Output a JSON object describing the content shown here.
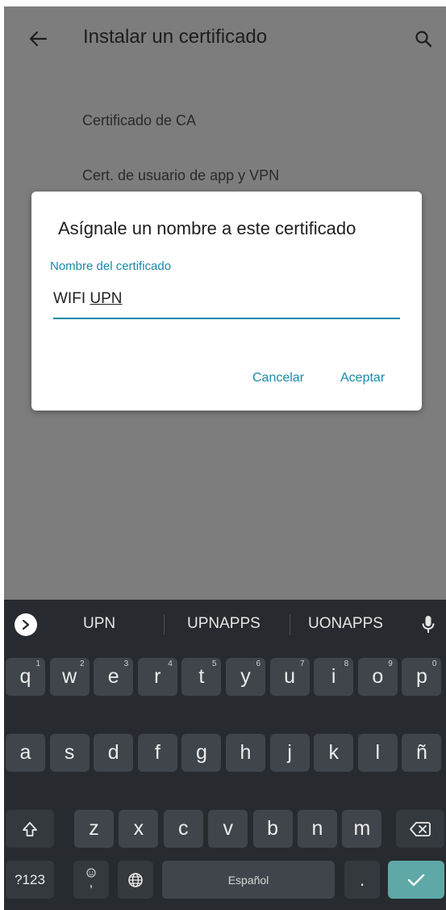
{
  "app_bar": {
    "title": "Instalar un certificado",
    "back_icon": "arrow-left-icon",
    "search_icon": "search-icon"
  },
  "settings": {
    "items": [
      {
        "label": "Certificado de CA"
      },
      {
        "label": "Cert. de usuario de app y VPN"
      }
    ]
  },
  "dialog": {
    "title": "Asígnale un nombre a este certificado",
    "field_label": "Nombre del certificado",
    "field_value_prefix": "WIFI ",
    "field_value_composing": "UPN",
    "cancel_label": "Cancelar",
    "accept_label": "Aceptar"
  },
  "keyboard": {
    "suggestions": [
      "UPN",
      "UPNAPPS",
      "UONAPPS"
    ],
    "row1": [
      {
        "label": "q",
        "hint": "1"
      },
      {
        "label": "w",
        "hint": "2"
      },
      {
        "label": "e",
        "hint": "3"
      },
      {
        "label": "r",
        "hint": "4"
      },
      {
        "label": "t",
        "hint": "5"
      },
      {
        "label": "y",
        "hint": "6"
      },
      {
        "label": "u",
        "hint": "7"
      },
      {
        "label": "i",
        "hint": "8"
      },
      {
        "label": "o",
        "hint": "9"
      },
      {
        "label": "p",
        "hint": "0"
      }
    ],
    "row2": [
      "a",
      "s",
      "d",
      "f",
      "g",
      "h",
      "j",
      "k",
      "l",
      "ñ"
    ],
    "row3": [
      "z",
      "x",
      "c",
      "v",
      "b",
      "n",
      "m"
    ],
    "numbers_label": "?123",
    "emoji_hint": ",",
    "space_label": "Español",
    "period_label": "."
  },
  "colors": {
    "accent": "#1a8aa8",
    "scrim": "#7d7d7d",
    "keyboard_bg": "#272b2f",
    "key_bg": "#40454b",
    "enter_key": "#5fa8a8"
  }
}
